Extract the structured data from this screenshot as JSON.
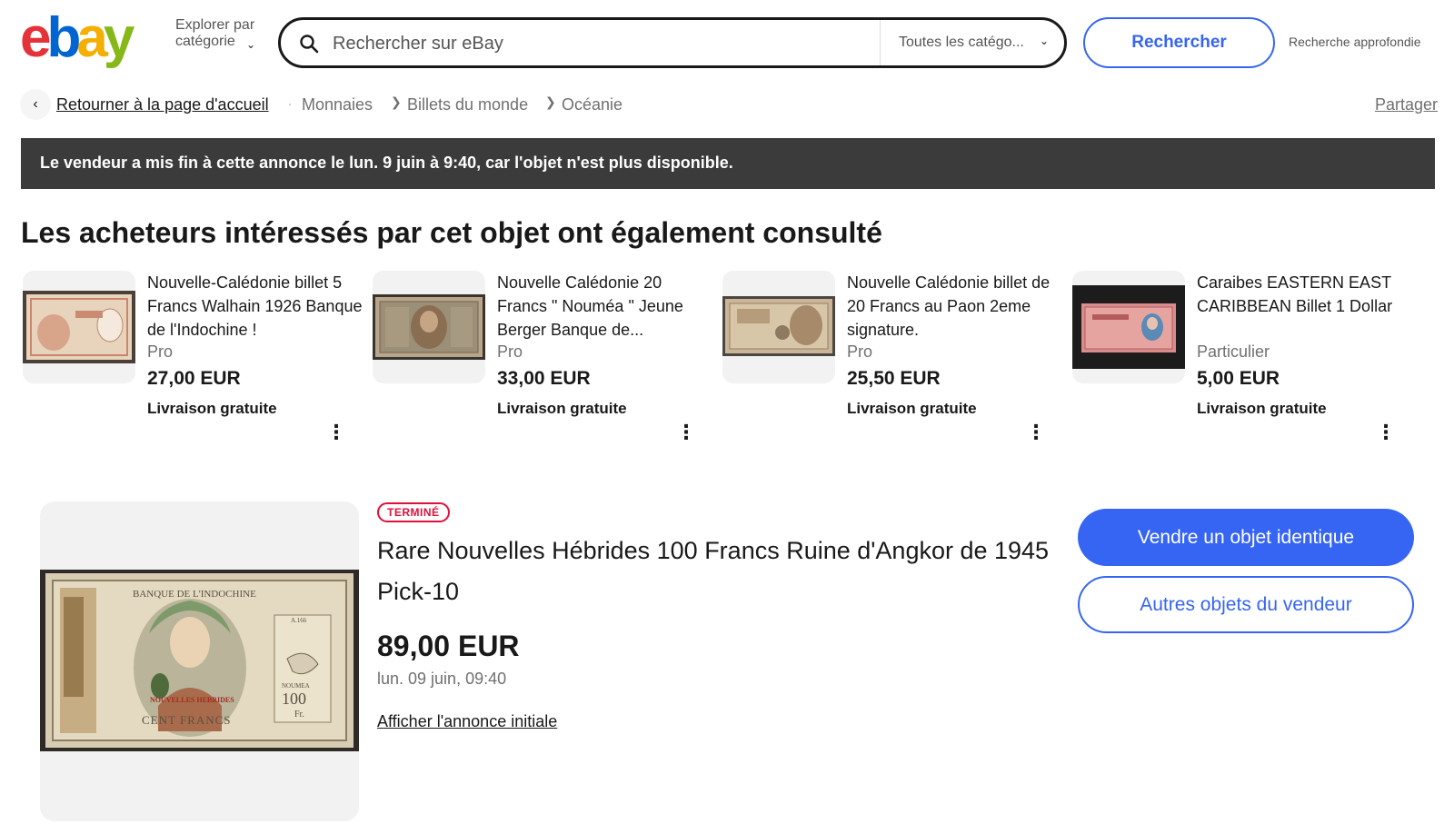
{
  "header": {
    "logo": "ebay",
    "logo_colors": [
      "#e53238",
      "#0064d2",
      "#f5af02",
      "#86b817"
    ],
    "explore_label": "Explorer par catégorie",
    "search_placeholder": "Rechercher sur eBay",
    "category_select": "Toutes les catégo...",
    "search_button": "Rechercher",
    "advanced_search": "Recherche approfondie"
  },
  "breadcrumb": {
    "home": "Retourner à la page d'accueil",
    "items": [
      "Monnaies",
      "Billets du monde",
      "Océanie"
    ],
    "share": "Partager"
  },
  "banner": {
    "text": "Le vendeur a mis fin à cette annonce le lun. 9 juin à 9:40, car l'objet n'est plus disponible."
  },
  "related": {
    "title": "Les acheteurs intéressés par cet objet ont également consulté",
    "items": [
      {
        "title": "Nouvelle-Calédonie billet 5 Francs Walhain 1926 Banque de l'Indochine !",
        "condition": "Pro",
        "price": "27,00 EUR",
        "shipping": "Livraison gratuite"
      },
      {
        "title": "Nouvelle Calédonie 20 Francs \" Nouméa \" Jeune Berger Banque de...",
        "condition": "Pro",
        "price": "33,00 EUR",
        "shipping": "Livraison gratuite"
      },
      {
        "title": "Nouvelle Calédonie billet de 20 Francs au Paon 2eme signature.",
        "condition": "Pro",
        "price": "25,50 EUR",
        "shipping": "Livraison gratuite"
      },
      {
        "title": "Caraibes EASTERN EAST CARIBBEAN Billet 1 Dollar",
        "condition": "Particulier",
        "price": "5,00 EUR",
        "shipping": "Livraison gratuite"
      }
    ]
  },
  "item": {
    "status": "TERMINÉ",
    "title": "Rare Nouvelles Hébrides 100 Francs Ruine d'Angkor de 1945 Pick-10",
    "price": "89,00 EUR",
    "end_date": "lun. 09 juin, 09:40",
    "view_original": "Afficher l'annonce initiale",
    "sell_button": "Vendre un objet identique",
    "seller_button": "Autres objets du vendeur",
    "banknote_text": {
      "top": "BANQUE DE L'INDOCHINE",
      "bottom": "CENT FRANCS",
      "place": "NOUMEA",
      "value": "100",
      "unit": "Fr.",
      "overprint": "NOUVELLES HEBRIDES",
      "serial": "A.166"
    }
  },
  "colors": {
    "accent": "#3665f3",
    "banner": "#3b3b3b",
    "ended": "#e0103a"
  }
}
